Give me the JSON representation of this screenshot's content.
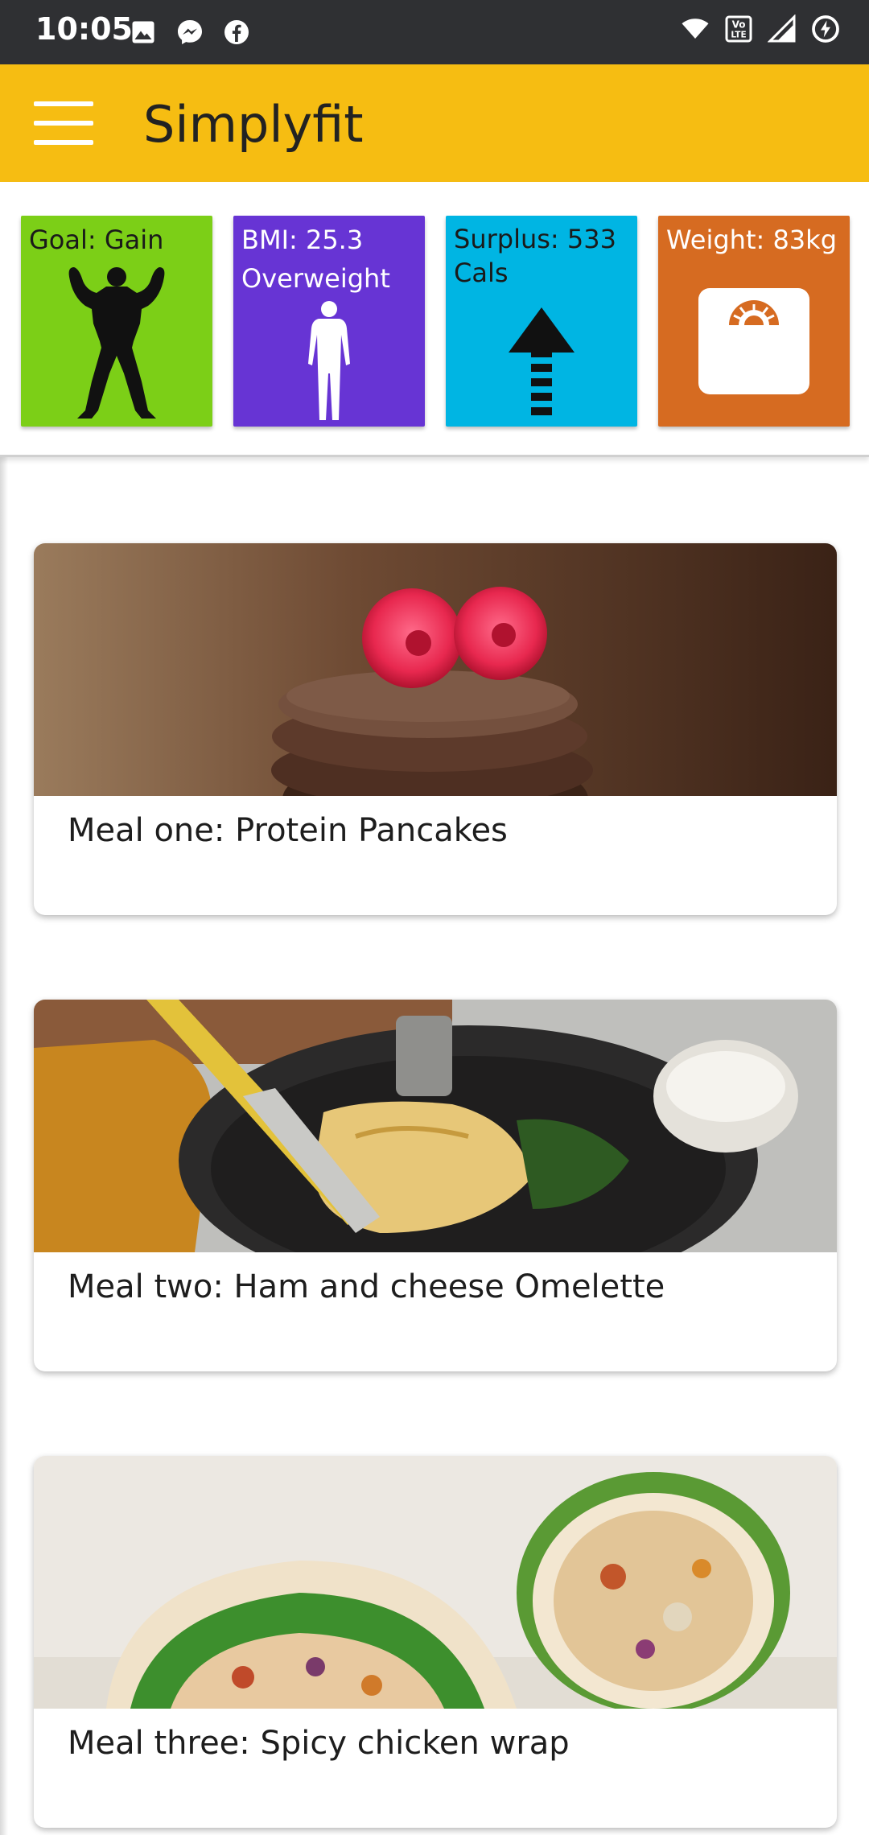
{
  "status_bar": {
    "time": "10:05",
    "left_icons": [
      "gallery-icon",
      "messenger-icon",
      "facebook-icon"
    ],
    "right_icons": [
      "wifi-icon",
      "volte-icon",
      "signal-icon",
      "battery-saver-icon"
    ]
  },
  "app_bar": {
    "title": "Simplyfit",
    "color": "#f6bd12"
  },
  "tiles": [
    {
      "id": "goal",
      "text": "Goal: Gain",
      "icon": "bodybuilder-icon",
      "color": "#7ccf17"
    },
    {
      "id": "bmi",
      "lines": [
        "BMI: 25.3",
        "Overweight"
      ],
      "icon": "human-body-icon",
      "color": "#6734d4"
    },
    {
      "id": "surplus",
      "lines": [
        "Surplus: 533",
        "Cals"
      ],
      "icon": "arrow-up-icon",
      "color": "#00b5e3"
    },
    {
      "id": "weight",
      "text": "Weight: 83kg",
      "icon": "scale-icon",
      "color": "#d66b21"
    }
  ],
  "meals": [
    {
      "label": "Meal one: Protein Pancakes",
      "photo": "protein-pancakes-photo"
    },
    {
      "label": "Meal two: Ham and cheese Omelette",
      "photo": "omelette-photo"
    },
    {
      "label": "Meal three: Spicy chicken wrap",
      "photo": "chicken-wrap-photo"
    }
  ]
}
